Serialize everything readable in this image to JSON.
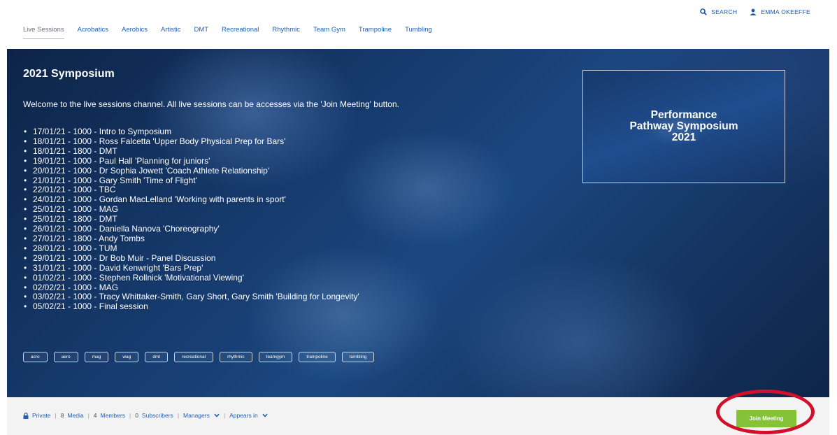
{
  "topbar": {
    "search_label": "SEARCH",
    "user_name": "EMMA OKEEFFE"
  },
  "nav": [
    {
      "label": "Live Sessions",
      "active": true
    },
    {
      "label": "Acrobatics"
    },
    {
      "label": "Aerobics"
    },
    {
      "label": "Artistic"
    },
    {
      "label": "DMT"
    },
    {
      "label": "Recreational"
    },
    {
      "label": "Rhythmic"
    },
    {
      "label": "Team Gym"
    },
    {
      "label": "Trampoline"
    },
    {
      "label": "Tumbling"
    }
  ],
  "hero": {
    "title": "2021 Symposium",
    "intro": "Welcome to the live sessions channel.  All live sessions can be accesses via the 'Join Meeting' button.",
    "sessions": [
      "17/01/21 - 1000 - Intro to Symposium",
      "18/01/21 - 1000 - Ross Falcetta 'Upper Body Physical Prep for Bars'",
      "18/01/21 - 1800 - DMT",
      "19/01/21 - 1000 - Paul Hall 'Planning for juniors'",
      "20/01/21 - 1000 - Dr Sophia Jowett 'Coach Athlete Relationship'",
      "21/01/21 - 1000 - Gary Smith 'Time of Flight'",
      "22/01/21 - 1000 - TBC",
      "24/01/21 - 1000 - Gordan MacLelland 'Working with parents in sport'",
      "25/01/21 - 1000 - MAG",
      "25/01/21 - 1800 - DMT",
      "26/01/21 - 1000 - Daniella Nanova 'Choreography'",
      "27/01/21 - 1800 - Andy Tombs",
      "28/01/21 - 1000 - TUM",
      "29/01/21 - 1000 - Dr Bob Muir - Panel Discussion",
      "31/01/21 - 1000 - David Kenwright 'Bars Prep'",
      "01/02/21 - 1000 - Stephen Rollnick 'Motivational Viewing'",
      "02/02/21 - 1000 - MAG",
      "03/02/21 - 1000 - Tracy Whittaker-Smith, Gary Short, Gary Smith 'Building for Longevity'",
      "05/02/21 - 1000 - Final session"
    ],
    "tags": [
      "acro",
      "aero",
      "mag",
      "wag",
      "dmt",
      "recreational",
      "rhythmic",
      "teamgym",
      "trampoline",
      "tumbling"
    ],
    "poster_title": "Performance Pathway Symposium 2021"
  },
  "footer": {
    "private_label": "Private",
    "media_count": "8",
    "media_label": "Media",
    "members_count": "4",
    "members_label": "Members",
    "subscribers_count": "0",
    "subscribers_label": "Subscribers",
    "managers_label": "Managers",
    "appears_in_label": "Appears in",
    "join_label": "Join Meeting"
  },
  "colors": {
    "accent_blue": "#2360b0",
    "join_green": "#86c238",
    "highlight_red": "#d2102c"
  }
}
